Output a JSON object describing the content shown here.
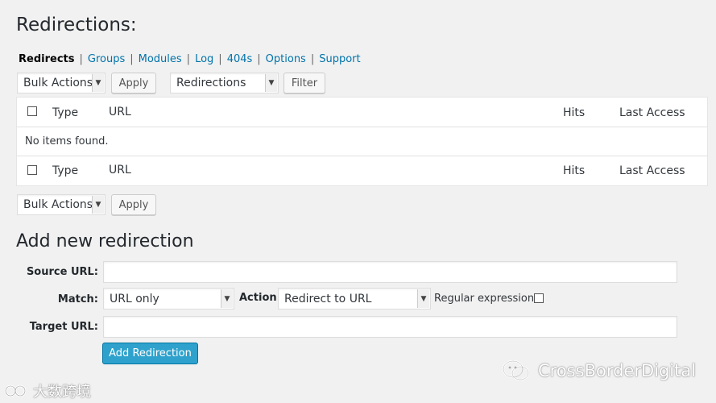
{
  "page": {
    "title": "Redirections:"
  },
  "subnav": {
    "items": [
      "Redirects",
      "Groups",
      "Modules",
      "Log",
      "404s",
      "Options",
      "Support"
    ],
    "separator": "|"
  },
  "tablenav_top": {
    "bulk_select": "Bulk Actions",
    "apply_label": "Apply",
    "filter_select": "Redirections",
    "filter_label": "Filter"
  },
  "table": {
    "columns": {
      "type": "Type",
      "url": "URL",
      "hits": "Hits",
      "last_access": "Last Access"
    },
    "empty_message": "No items found."
  },
  "tablenav_bottom": {
    "bulk_select": "Bulk Actions",
    "apply_label": "Apply"
  },
  "add_form": {
    "title": "Add new redirection",
    "source_label": "Source URL:",
    "source_value": "",
    "match_label": "Match:",
    "match_value": "URL only",
    "action_label": "Action:",
    "action_value": "Redirect to URL",
    "regex_label": "Regular expression:",
    "target_label": "Target URL:",
    "target_value": "",
    "submit_label": "Add Redirection"
  },
  "watermarks": {
    "left": "大数跨境",
    "right": "CrossBorderDigital"
  },
  "colors": {
    "accent": "#2ea2cc",
    "link": "#0073aa",
    "background": "#f1f1f1"
  }
}
